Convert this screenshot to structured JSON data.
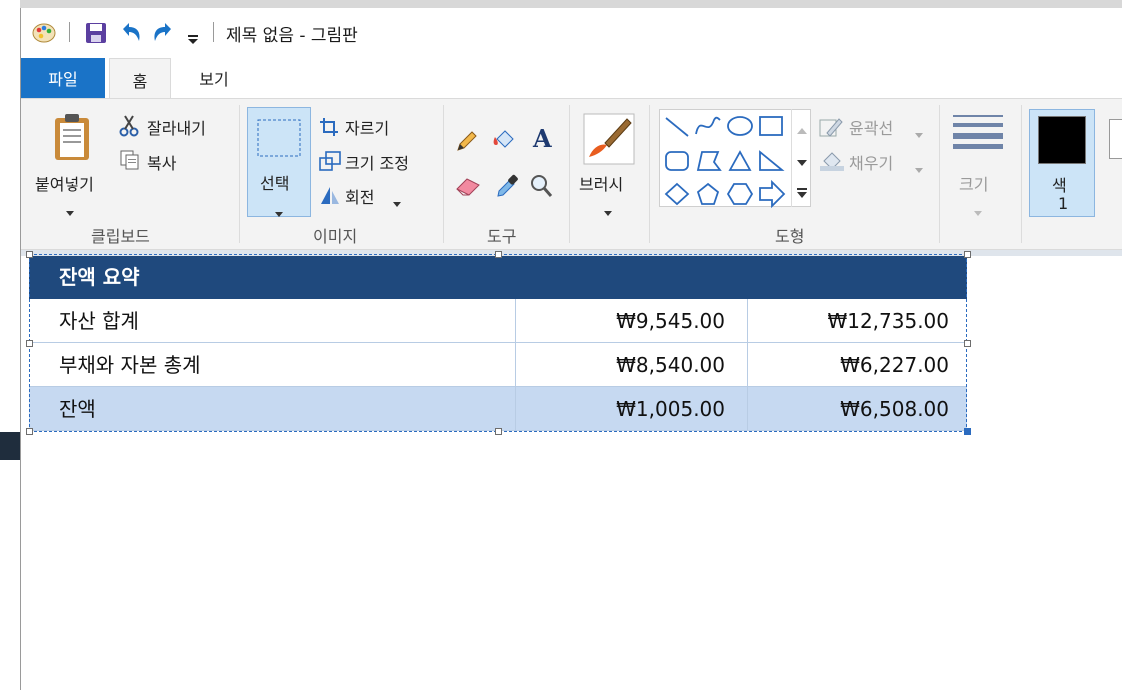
{
  "titlebar": {
    "title": "제목 없음 - 그림판"
  },
  "tabs": [
    {
      "label": "파일"
    },
    {
      "label": "홈"
    },
    {
      "label": "보기"
    }
  ],
  "ribbon": {
    "clipboard": {
      "paste_label": "붙여넣기",
      "cut_label": "잘라내기",
      "copy_label": "복사",
      "group_label": "클립보드"
    },
    "image": {
      "select_label": "선택",
      "crop_label": "자르기",
      "resize_label": "크기 조정",
      "rotate_label": "회전",
      "group_label": "이미지"
    },
    "tools": {
      "group_label": "도구"
    },
    "brush": {
      "label": "브러시"
    },
    "shapes": {
      "outline_label": "윤곽선",
      "fill_label": "채우기",
      "group_label": "도형"
    },
    "size": {
      "label": "크기"
    },
    "color1": {
      "label_top": "색",
      "label_bottom": "1",
      "color": "#000000"
    }
  },
  "table": {
    "header": "잔액 요약",
    "rows": [
      {
        "label": "자산 합계",
        "v1": "₩9,545.00",
        "v2": "₩12,735.00"
      },
      {
        "label": "부채와 자본 총계",
        "v1": "₩8,540.00",
        "v2": "₩6,227.00"
      },
      {
        "label": "잔액",
        "v1": "₩1,005.00",
        "v2": "₩6,508.00"
      }
    ],
    "header_color": "#1f497d",
    "total_row_color": "#c6d9f1"
  },
  "colors": {
    "accent": "#1a73c7"
  }
}
